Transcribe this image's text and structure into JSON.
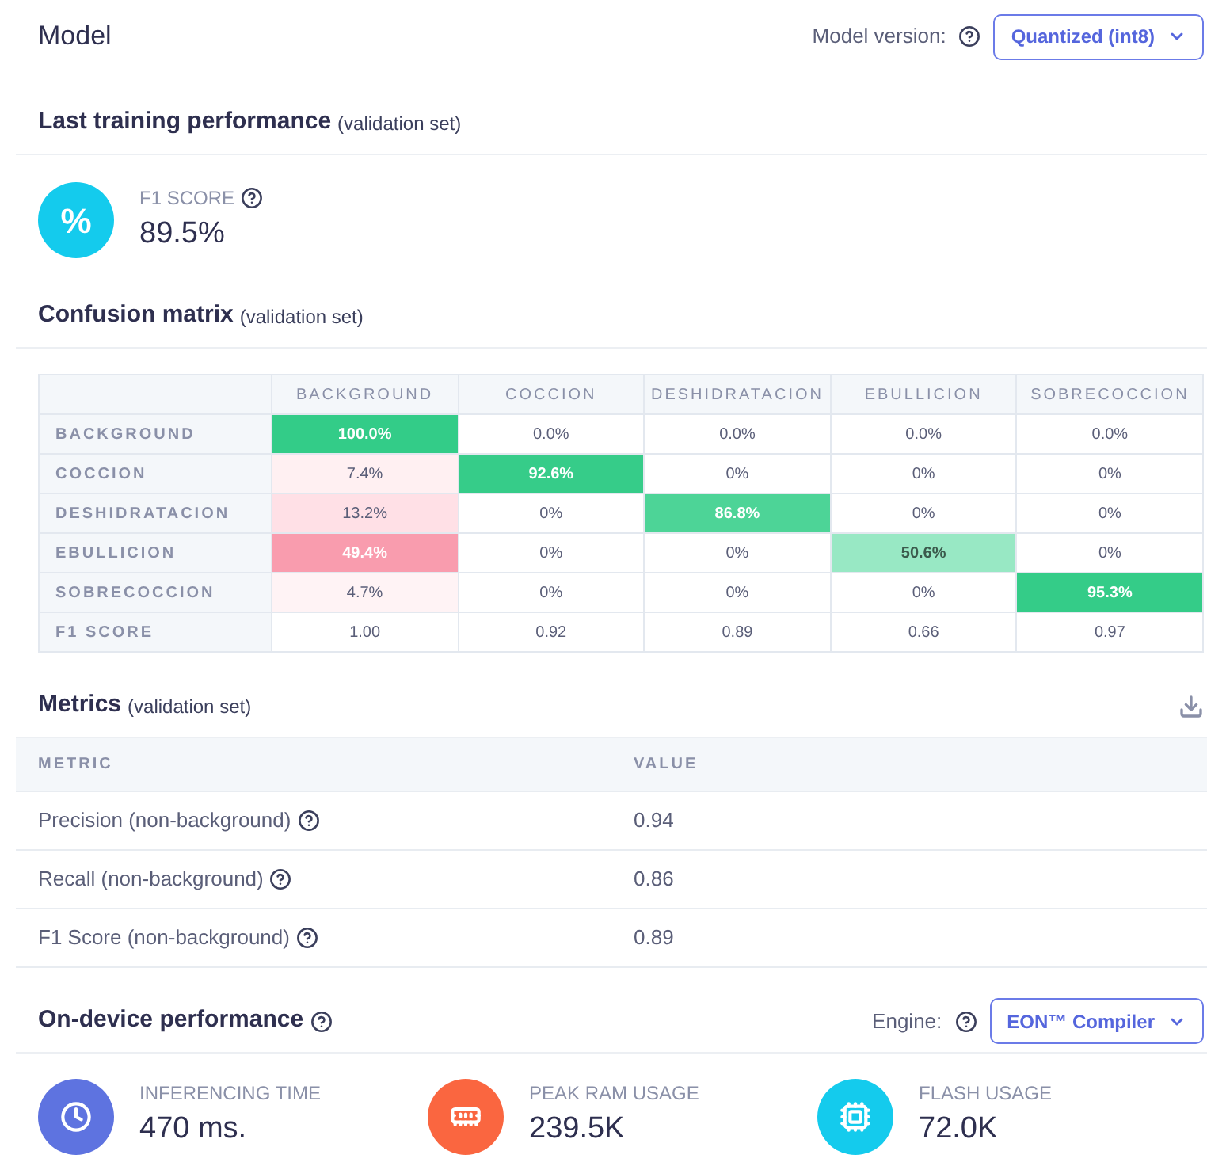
{
  "header": {
    "title": "Model",
    "version_label": "Model version:",
    "version_value": "Quantized (int8)"
  },
  "training": {
    "title": "Last training performance",
    "note": "(validation set)",
    "score_label": "F1 SCORE",
    "score_value": "89.5%",
    "icon_text": "%"
  },
  "confusion": {
    "title": "Confusion matrix",
    "note": "(validation set)",
    "columns": [
      "BACKGROUND",
      "COCCION",
      "DESHIDRATACION",
      "EBULLICION",
      "SOBRECOCCION"
    ],
    "rows": [
      {
        "label": "BACKGROUND",
        "cells": [
          {
            "value": "100.0%",
            "color": "#33cc88"
          },
          {
            "value": "0.0%"
          },
          {
            "value": "0.0%"
          },
          {
            "value": "0.0%"
          },
          {
            "value": "0.0%"
          }
        ]
      },
      {
        "label": "COCCION",
        "cells": [
          {
            "value": "7.4%",
            "color": "#fff0f2"
          },
          {
            "value": "92.6%",
            "color": "#36cc89"
          },
          {
            "value": "0%"
          },
          {
            "value": "0%"
          },
          {
            "value": "0%"
          }
        ]
      },
      {
        "label": "DESHIDRATACION",
        "cells": [
          {
            "value": "13.2%",
            "color": "#ffe0e6"
          },
          {
            "value": "0%"
          },
          {
            "value": "86.8%",
            "color": "#4dd497"
          },
          {
            "value": "0%"
          },
          {
            "value": "0%"
          }
        ]
      },
      {
        "label": "EBULLICION",
        "cells": [
          {
            "value": "49.4%",
            "color": "#f99cae"
          },
          {
            "value": "0%"
          },
          {
            "value": "0%"
          },
          {
            "value": "50.6%",
            "color": "#98e8c4"
          },
          {
            "value": "0%"
          }
        ]
      },
      {
        "label": "SOBRECOCCION",
        "cells": [
          {
            "value": "4.7%",
            "color": "#fff3f5"
          },
          {
            "value": "0%"
          },
          {
            "value": "0%"
          },
          {
            "value": "0%"
          },
          {
            "value": "95.3%",
            "color": "#34cc88"
          }
        ]
      },
      {
        "label": "F1 SCORE",
        "cells": [
          {
            "value": "1.00"
          },
          {
            "value": "0.92"
          },
          {
            "value": "0.89"
          },
          {
            "value": "0.66"
          },
          {
            "value": "0.97"
          }
        ]
      }
    ]
  },
  "metrics": {
    "title": "Metrics",
    "note": "(validation set)",
    "columns": [
      "METRIC",
      "VALUE"
    ],
    "rows": [
      {
        "metric": "Precision (non-background)",
        "value": "0.94"
      },
      {
        "metric": "Recall (non-background)",
        "value": "0.86"
      },
      {
        "metric": "F1 Score (non-background)",
        "value": "0.89"
      }
    ]
  },
  "device": {
    "title": "On-device performance",
    "engine_label": "Engine:",
    "engine_value": "EON™ Compiler",
    "stats": [
      {
        "kind": "time",
        "label": "INFERENCING TIME",
        "value": "470 ms.",
        "color": "#5e73e0"
      },
      {
        "kind": "ram",
        "label": "PEAK RAM USAGE",
        "value": "239.5K",
        "color": "#fa6640"
      },
      {
        "kind": "flash",
        "label": "FLASH USAGE",
        "value": "72.0K",
        "color": "#14cbed"
      }
    ]
  }
}
